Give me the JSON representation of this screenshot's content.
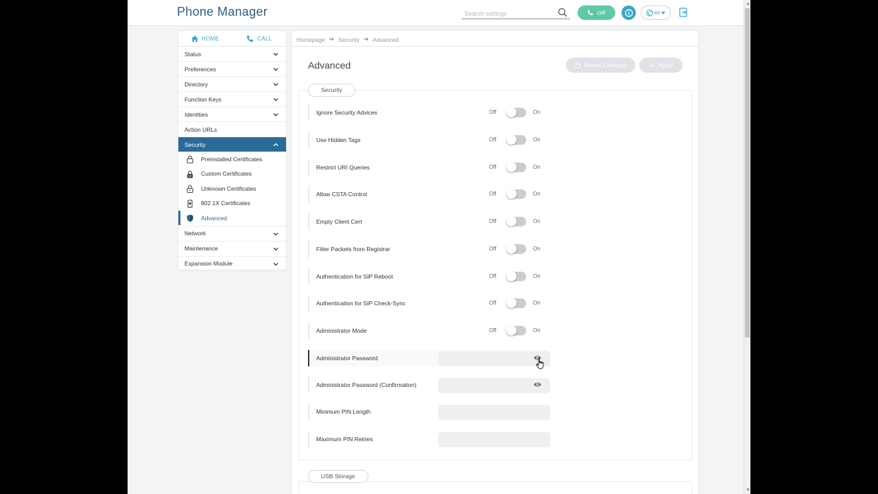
{
  "header": {
    "title": "Phone Manager",
    "search_placeholder": "Search settings",
    "call_label": "call",
    "language": "en"
  },
  "sidebar": {
    "home_label": "HOME",
    "call_label": "CALL",
    "items": [
      {
        "label": "Status"
      },
      {
        "label": "Preferences"
      },
      {
        "label": "Directory"
      },
      {
        "label": "Function Keys"
      },
      {
        "label": "Identities"
      },
      {
        "label": "Action URLs"
      },
      {
        "label": "Security"
      },
      {
        "label": "Network"
      },
      {
        "label": "Maintenance"
      },
      {
        "label": "Expansion Module"
      }
    ],
    "security_sub": [
      {
        "label": "Preinstalled Certificates"
      },
      {
        "label": "Custom Certificates"
      },
      {
        "label": "Unknown Certificates"
      },
      {
        "label": "802.1X Certificates"
      },
      {
        "label": "Advanced"
      }
    ]
  },
  "breadcrumb": [
    "Homepage",
    "Security",
    "Advanced"
  ],
  "page": {
    "title": "Advanced",
    "revert_label": "Revert Changes",
    "apply_label": "Apply"
  },
  "security_group": {
    "label": "Security",
    "off_label": "Off",
    "on_label": "On",
    "toggles": [
      {
        "label": "Ignore Security Advices"
      },
      {
        "label": "Use Hidden Tags"
      },
      {
        "label": "Restrict URI Queries"
      },
      {
        "label": "Allow CSTA Control"
      },
      {
        "label": "Empty Client Cert"
      },
      {
        "label": "Filter Packets from Registrar"
      },
      {
        "label": "Authentication for SIP Reboot"
      },
      {
        "label": "Authentication for SIP Check-Sync"
      },
      {
        "label": "Administrator Mode"
      }
    ],
    "fields": [
      {
        "label": "Administrator Password",
        "value": ""
      },
      {
        "label": "Administrator Password (Confirmation)",
        "value": ""
      },
      {
        "label": "Minimum PIN Length",
        "value": ""
      },
      {
        "label": "Maximum PIN Retries",
        "value": ""
      }
    ]
  },
  "usb_group": {
    "label": "USB Storage"
  },
  "colors": {
    "brand": "#2c5f86",
    "accent": "#3aa6c6",
    "call_green": "#5fc9a8",
    "active_nav": "#2b6b98"
  }
}
